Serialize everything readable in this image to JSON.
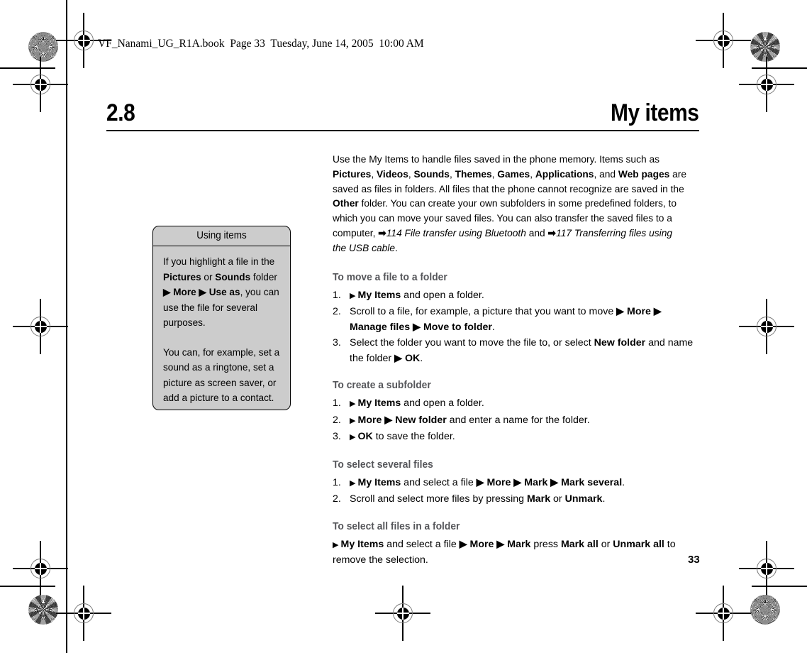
{
  "file_header": "VF_Nanami_UG_R1A.book  Page 33  Tuesday, June 14, 2005  10:00 AM",
  "chapter": {
    "number": "2.8",
    "title": "My items"
  },
  "page_number": "33",
  "note_box": {
    "title": "Using items",
    "paragraph_1": {
      "part_1": "If you highlight a file in the ",
      "bold_1": "Pictures",
      "part_2": " or ",
      "bold_2": "Sounds",
      "part_3": " folder ",
      "bold_3": "▶ More ▶ Use as",
      "part_4": ", you can use the file for several purposes."
    },
    "paragraph_2": "You can, for example, set a sound as a ringtone, set a picture as screen saver, or add a picture to a contact."
  },
  "intro": {
    "t1": "Use the My Items to handle files saved in the phone memory. Items such as ",
    "b1": "Pictures",
    "t2": ", ",
    "b2": "Videos",
    "t3": ", ",
    "b3": "Sounds",
    "t4": ", ",
    "b4": "Themes",
    "t5": ", ",
    "b5": "Games",
    "t6": ", ",
    "b6": "Applications",
    "t7": ", and ",
    "b7": "Web pages",
    "t8": " are saved as files in folders. All files that the phone cannot recognize are saved in the ",
    "b8": "Other",
    "t9": " folder. You can create your own subfolders in some predefined folders, to which you can move your saved files. You can also transfer the saved files to a computer, ",
    "arrow_1": "➡",
    "xref_1": "114 File transfer using Bluetooth",
    "t10": " and ",
    "arrow_2": "➡",
    "xref_2": "117 Transferring files using the USB cable",
    "t11": "."
  },
  "sections": [
    {
      "heading": "To move a file to a folder",
      "steps": [
        {
          "p1": "▶ ",
          "b1": "My Items",
          "p2": " and open a folder."
        },
        {
          "p1": "Scroll to a file, for example, a picture that you want to move ",
          "b1": "▶ More ▶ Manage files ▶ Move to folder",
          "p2": "."
        },
        {
          "p1": "Select the folder you want to move the file to, or select ",
          "b1": "New folder",
          "p2": " and name the folder ",
          "b2": "▶ OK",
          "p3": "."
        }
      ]
    },
    {
      "heading": "To create a subfolder",
      "steps": [
        {
          "p1": "▶ ",
          "b1": "My Items",
          "p2": " and open a folder."
        },
        {
          "p1": "▶ ",
          "b1": "More ▶ New folder",
          "p2": " and enter a name for the folder."
        },
        {
          "p1": "▶ ",
          "b1": "OK",
          "p2": " to save the folder."
        }
      ]
    },
    {
      "heading": "To select several files",
      "steps": [
        {
          "p1": "▶ ",
          "b1": "My Items",
          "p2": " and select a file ",
          "b2": "▶ More ▶ Mark ▶ Mark several",
          "p3": "."
        },
        {
          "p1": "Scroll and select more files by pressing ",
          "b1": "Mark",
          "p2": " or ",
          "b2": "Unmark",
          "p3": "."
        }
      ]
    },
    {
      "heading": "To select all files in a folder",
      "paragraph": {
        "p1": "▶ ",
        "b1": "My Items",
        "p2": " and select a file ",
        "b2": "▶ More ▶ Mark",
        "p3": " press ",
        "b3": "Mark all",
        "p4": " or ",
        "b4": "Unmark all",
        "p5": " to remove the selection."
      }
    }
  ],
  "colors": {
    "note_background": "#cccccc",
    "section_heading": "#55565a",
    "text": "#000000"
  }
}
